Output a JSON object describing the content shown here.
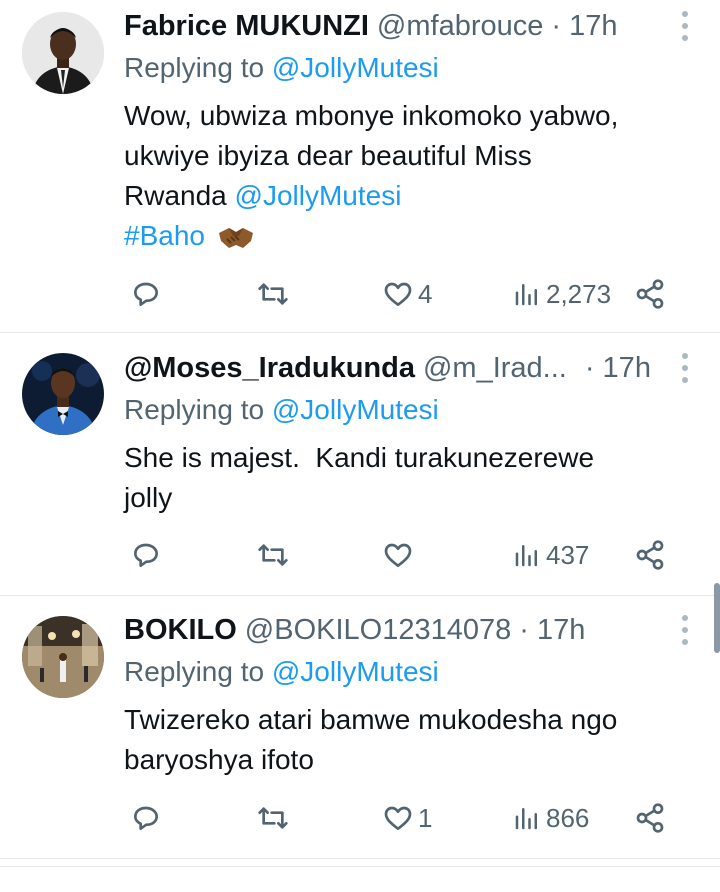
{
  "tweets": [
    {
      "name": "Fabrice MUKUNZI",
      "handle": "@mfabrouce",
      "time": "· 17h",
      "replying_prefix": "Replying to",
      "replying_to": "@JollyMutesi",
      "body_line1": "Wow, ubwiza mbonye inkomoko yabwo,",
      "body_line2": "ukwiye ibyiza dear beautiful Miss",
      "body_line3_text": "Rwanda",
      "body_line3_mention": "@JollyMutesi",
      "hashtag": "#Baho",
      "emoji": "handshake",
      "likes": "4",
      "views": "2,273"
    },
    {
      "name": "@Moses_Iradukunda",
      "handle": "@m_Irad...",
      "time": "· 17h",
      "replying_prefix": "Replying to",
      "replying_to": "@JollyMutesi",
      "body_line1": "She is majest.  Kandi turakunezerewe",
      "body_line2": "jolly",
      "likes": "",
      "views": "437"
    },
    {
      "name": "BOKILO",
      "handle": "@BOKILO12314078",
      "time": "· 17h",
      "replying_prefix": "Replying to",
      "replying_to": "@JollyMutesi",
      "body_line1": "Twizereko atari bamwe mukodesha ngo",
      "body_line2": "baryoshya ifoto",
      "likes": "1",
      "views": "866"
    }
  ],
  "colors": {
    "text": "#0f1419",
    "secondary": "#536471",
    "link": "#1d9bf0",
    "divider": "#e6e9eb"
  },
  "icons": [
    "reply-icon",
    "retweet-icon",
    "like-icon",
    "views-icon",
    "share-icon",
    "more-icon"
  ]
}
